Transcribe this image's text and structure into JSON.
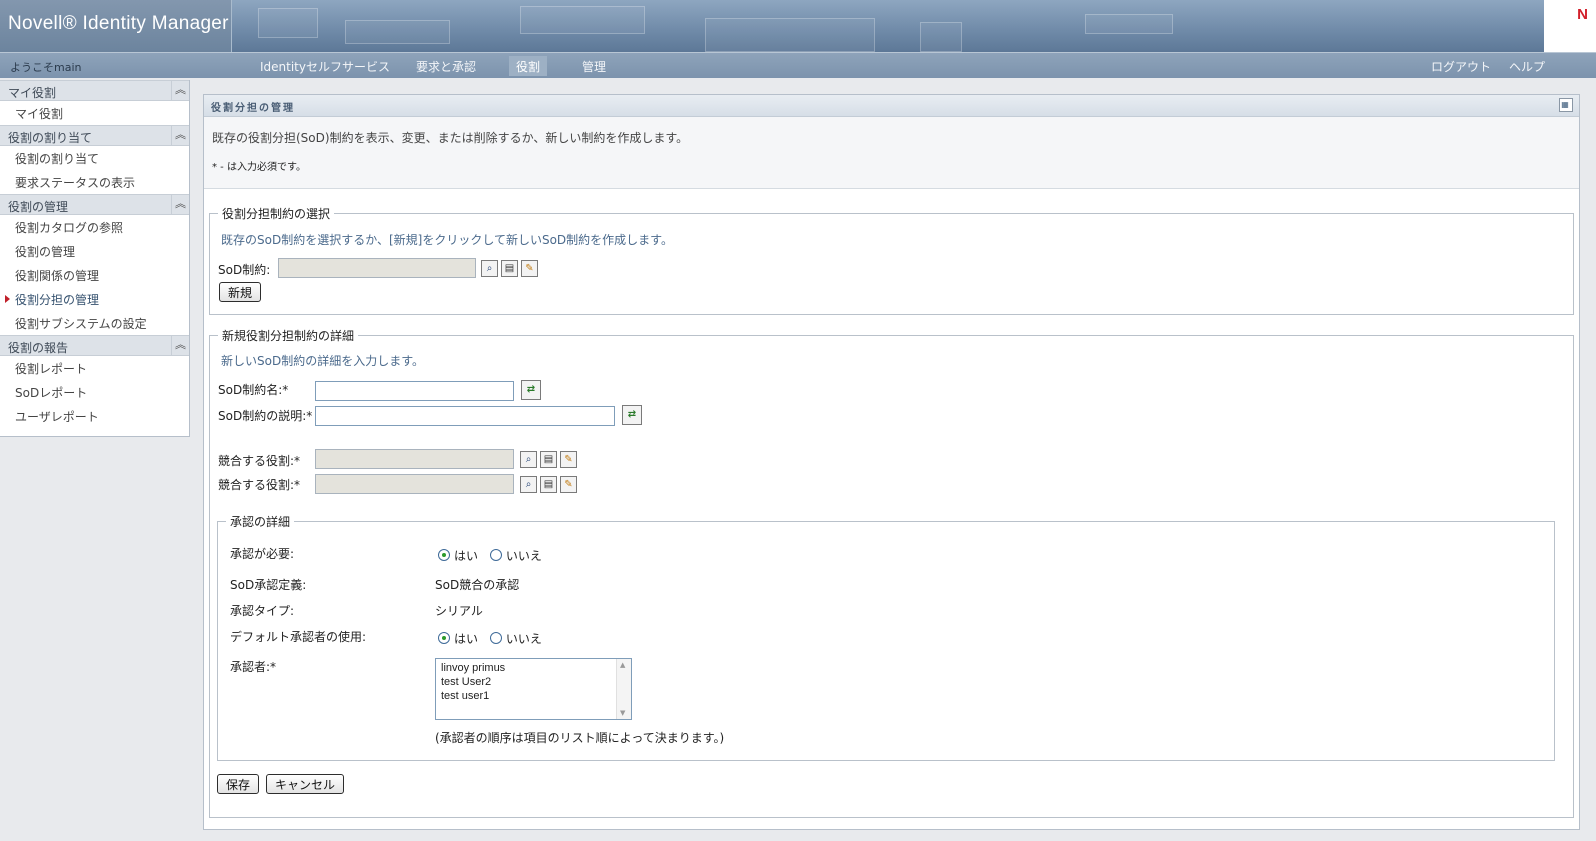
{
  "header": {
    "brand": "Novell® Identity Manager",
    "logo_letter": "N"
  },
  "nav": {
    "welcome": "ようこそmain",
    "tabs": [
      {
        "label": "Identityセルフサービス"
      },
      {
        "label": "要求と承認"
      },
      {
        "label": "役割"
      },
      {
        "label": "管理"
      }
    ],
    "active_tab": "役割",
    "logout": "ログアウト",
    "help": "ヘルプ"
  },
  "sidebar": {
    "sections": [
      {
        "title": "マイ役割",
        "items": [
          "マイ役割"
        ]
      },
      {
        "title": "役割の割り当て",
        "items": [
          "役割の割り当て",
          "要求ステータスの表示"
        ]
      },
      {
        "title": "役割の管理",
        "items": [
          "役割カタログの参照",
          "役割の管理",
          "役割関係の管理",
          "役割分担の管理",
          "役割サブシステムの設定"
        ]
      },
      {
        "title": "役割の報告",
        "items": [
          "役割レポート",
          "SoDレポート",
          "ユーザレポート"
        ]
      }
    ],
    "current_item": "役割分担の管理",
    "collapse_icon": "double-chevron-up-icon"
  },
  "panel": {
    "title": "役割分担の管理",
    "description": "既存の役割分担(SoD)制約を表示、変更、または削除するか、新しい制約を作成します。",
    "required_note": "* - は入力必須です。"
  },
  "select_section": {
    "legend": "役割分担制約の選択",
    "hint": "既存のSoD制約を選択するか、[新規]をクリックして新しいSoD制約を作成します。",
    "label": "SoD制約:",
    "value": "",
    "new_button": "新規"
  },
  "detail_section": {
    "legend": "新規役割分担制約の詳細",
    "hint": "新しいSoD制約の詳細を入力します。",
    "name_label": "SoD制約名:*",
    "name_value": "",
    "desc_label": "SoD制約の説明:*",
    "desc_value": "",
    "conflict1_label": "競合する役割:*",
    "conflict2_label": "競合する役割:*"
  },
  "approval_section": {
    "legend": "承認の詳細",
    "required_label": "承認が必要:",
    "yes": "はい",
    "no": "いいえ",
    "required_selected": "はい",
    "definition_label": "SoD承認定義:",
    "definition_value": "SoD競合の承認",
    "type_label": "承認タイプ:",
    "type_value": "シリアル",
    "default_label": "デフォルト承認者の使用:",
    "default_selected": "はい",
    "approvers_label": "承認者:*",
    "approvers": [
      "linvoy primus",
      "test User2",
      "test user1"
    ],
    "order_note": "(承認者の順序は項目のリスト順によって決まります。)"
  },
  "buttons": {
    "save": "保存",
    "cancel": "キャンセル"
  },
  "colors": {
    "banner": "#6f8aa8",
    "accent_text": "#4b6a8c",
    "current_marker": "#c0202a"
  }
}
